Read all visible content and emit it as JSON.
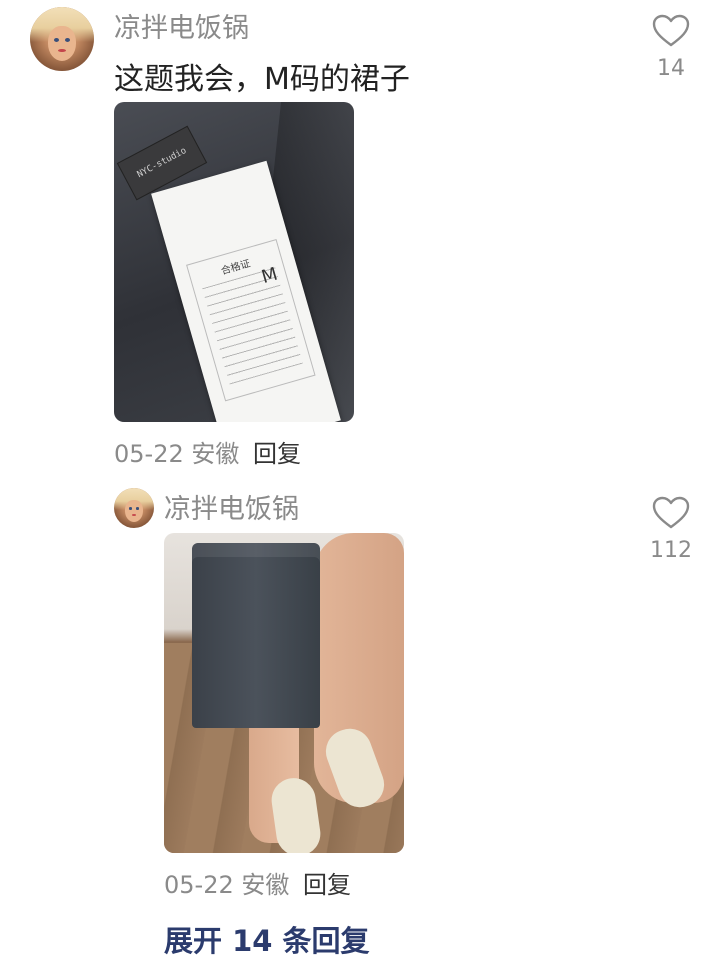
{
  "comments": [
    {
      "username": "凉拌电饭锅",
      "text": "这题我会，M码的裙子",
      "like_count": "14",
      "date": "05-22",
      "location": "安徽",
      "reply_label": "回复",
      "photo_tag_text": "NYC-studio",
      "photo_label_title": "合格证",
      "photo_label_size": "M"
    },
    {
      "username": "凉拌电饭锅",
      "like_count": "112",
      "date": "05-22",
      "location": "安徽",
      "reply_label": "回复"
    }
  ],
  "expand_replies_label": "展开 14 条回复",
  "icons": {
    "like": "heart-outline-icon"
  },
  "colors": {
    "username": "#8a8a8a",
    "expand_link": "#2b3b6d"
  }
}
